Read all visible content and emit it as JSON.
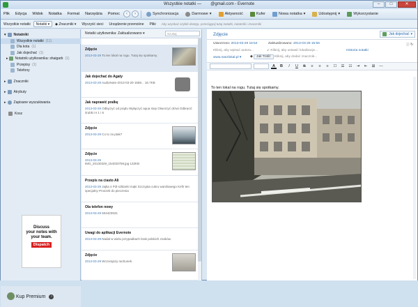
{
  "window": {
    "title": "Wszystkie notatki —        @gmail.com - Evernote",
    "minimize": "–",
    "maximize": "□",
    "close": "✕"
  },
  "menubar": {
    "menus": [
      "Plik",
      "Edycja",
      "Widok",
      "Notatka",
      "Format",
      "Narzędzia",
      "Pomoc"
    ],
    "sync": "Synchronizacja",
    "user": "Darmowe",
    "activity": "Aktywność",
    "cart": "Kufer",
    "new_note": "Nowa notatka",
    "share": "Udostępnij",
    "search_tab": "Wykorzystanie"
  },
  "toolbar": {
    "all_notes": "Wszystkie notatki",
    "notebooks": "Notatki",
    "tags": "Znaczniki",
    "clear": "Wyczyść sieci",
    "resized": "Urządzenie przenośne",
    "places": "Pliki",
    "hint": "Aby uzyskać szybki dostęp, przeciągnij tutaj notatki, notatniki i znaczniki"
  },
  "sidebar": {
    "notebooks_head": "Notatniki",
    "items": [
      {
        "label": "Wszystkie notatki",
        "count": "(11)"
      },
      {
        "label": "Dla kota",
        "count": "(1)"
      },
      {
        "label": "Jak dojechać",
        "count": "(1)"
      },
      {
        "label": "Notatnik użytkownika: shaigarb",
        "count": "(1)"
      },
      {
        "label": "Przepisy",
        "count": "(1)"
      },
      {
        "label": "Telefony",
        "count": ""
      }
    ],
    "tags": "Znaczniki",
    "attributes": "Atrybuty",
    "saved_searches": "Zapisane wyszukiwania",
    "trash": "Kosz",
    "ad": {
      "line1": "Discuss",
      "line2": "your notes with",
      "line3": "your team.",
      "brand": "Dispatch"
    },
    "premium": "Kup Premium"
  },
  "notelist": {
    "header": "Notatki użytkownika: Zaktualizowano ▾",
    "search_placeholder": "Szukaj",
    "notes": [
      {
        "title": "Zdjęcie",
        "date": "2013-03-29",
        "text": "To ten lokal na rogu. Tutaj się spotkamy."
      },
      {
        "title": "Jak dojechać do Agaty",
        "date": "2013-03-29",
        "text": "AudioNote-2013-03-29 1559... 16.7KB"
      },
      {
        "title": "Jak naprawić pralkę",
        "date": "2013-03-29",
        "text": "Odłączyć od prądu Wyłączyć aqua stop Otworzyć drzwi Odkręcić śrubki nr 1 i 6"
      },
      {
        "title": "Zdjęcie",
        "date": "2013-03-29",
        "text": "Co to za ptak?"
      },
      {
        "title": "Zdjęcie",
        "date": "2013-03-29",
        "text": "IMG_20130329_154033759.jpg 133KB"
      },
      {
        "title": "Przepis na ciasto Ali",
        "date": "2013-03-29",
        "text": "Jajka 4 Pół szklanki mąki Szczypta cukru waniliowego Kefir ten specjalny Proszek do pieczenia"
      },
      {
        "title": "Ola telefon nowy",
        "date": "2013-03-29",
        "text": "504423531"
      },
      {
        "title": "Uwagi do aplikacji Evernote",
        "date": "2013-03-29",
        "text": "Nadal w wielu przypadkach brak polskich znaków."
      },
      {
        "title": "Zdjęcie",
        "date": "2013-03-29",
        "text": "Wczorajszy rachunek."
      }
    ]
  },
  "editor": {
    "title": "Zdjęcie",
    "notebook": "Jak dojechać",
    "created_label": "Utworzono:",
    "created": "2013-03-29 15:54",
    "updated_label": "Zaktualizowano:",
    "updated": "2013-03-29 15:56",
    "author": "Kliknij, aby wpisać autora...",
    "location": "Kliknij, aby ustawić lokalizacje...",
    "history": "Historia notatki",
    "url": "www.naszlokal.pl",
    "tag": "Jak Trafić",
    "tag_placeholder": "Kliknij, aby dodać znacznik...",
    "body": "To ten lokal na rogu. Tutaj się spotkamy."
  }
}
